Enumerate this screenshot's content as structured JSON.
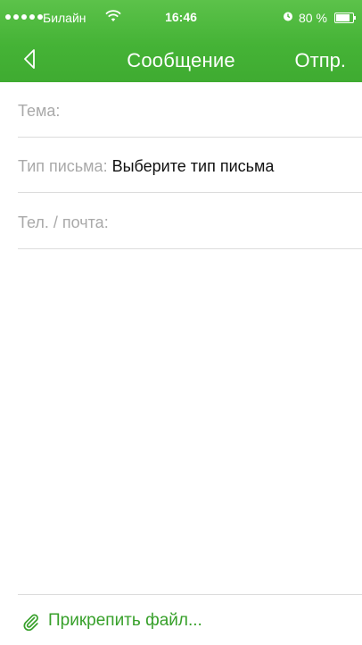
{
  "status_bar": {
    "carrier": "Билайн",
    "time": "16:46",
    "battery_percent": "80 %",
    "icons": [
      "signal-dots",
      "wifi-icon",
      "alarm-icon",
      "battery-icon"
    ]
  },
  "nav": {
    "back_icon": "chevron-left-icon",
    "title": "Сообщение",
    "send_label": "Отпр."
  },
  "form": {
    "subject_label": "Тема:",
    "type_label": "Тип письма:",
    "type_value": "Выберите тип письма",
    "contact_label": "Тел. / почта:"
  },
  "attach": {
    "icon": "paperclip-icon",
    "label": "Прикрепить файл..."
  },
  "colors": {
    "header_green": "#45b336",
    "accent_green": "#37a02a",
    "placeholder_gray": "#a9a9a9",
    "divider": "#dcdcdc"
  }
}
